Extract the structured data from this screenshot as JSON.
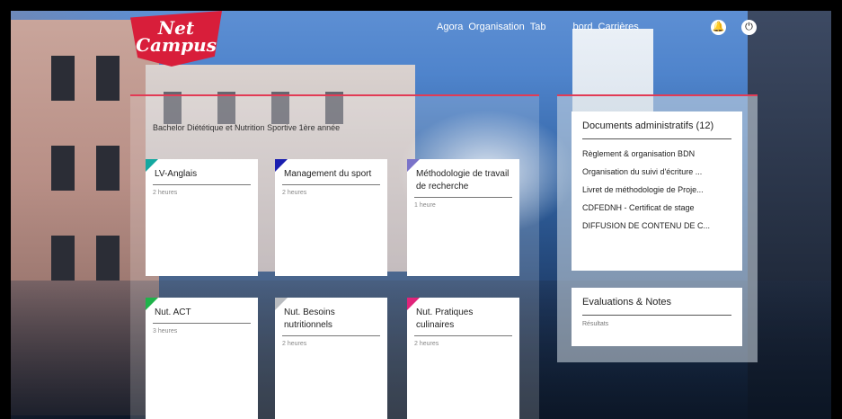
{
  "brand": {
    "line1": "Net",
    "line2": "Campus"
  },
  "nav": {
    "items": [
      "Agora",
      "Organisation",
      "Tab",
      "bord",
      "Carrières"
    ],
    "icons": [
      "bell-icon",
      "power-icon"
    ]
  },
  "program": {
    "title": "Bachelor Diététique et Nutrition Sportive 1ère année"
  },
  "courses": [
    {
      "title": "LV-Anglais",
      "meta": "2 heures",
      "color": "#14a8a0"
    },
    {
      "title": "Management du sport",
      "meta": "2 heures",
      "color": "#1a1fb0"
    },
    {
      "title": "Méthodologie de travail de recherche",
      "meta": "1 heure",
      "color": "#7a73c9"
    },
    {
      "title": "Nut. ACT",
      "meta": "3 heures",
      "color": "#1fb34a"
    },
    {
      "title": "Nut. Besoins nutritionnels",
      "meta": "2 heures",
      "color": "#b9bcc0"
    },
    {
      "title": "Nut. Pratiques culinaires",
      "meta": "2 heures",
      "color": "#e0247a"
    }
  ],
  "documents": {
    "title": "Documents administratifs (12)",
    "items": [
      "Règlement & organisation BDN",
      "Organisation du suivi d'écriture ...",
      "Livret de méthodologie de Proje...",
      "CDFEDNH - Certificat de stage",
      "DIFFUSION DE CONTENU DE C..."
    ]
  },
  "evaluations": {
    "title": "Evaluations & Notes",
    "meta": "Résultats"
  }
}
